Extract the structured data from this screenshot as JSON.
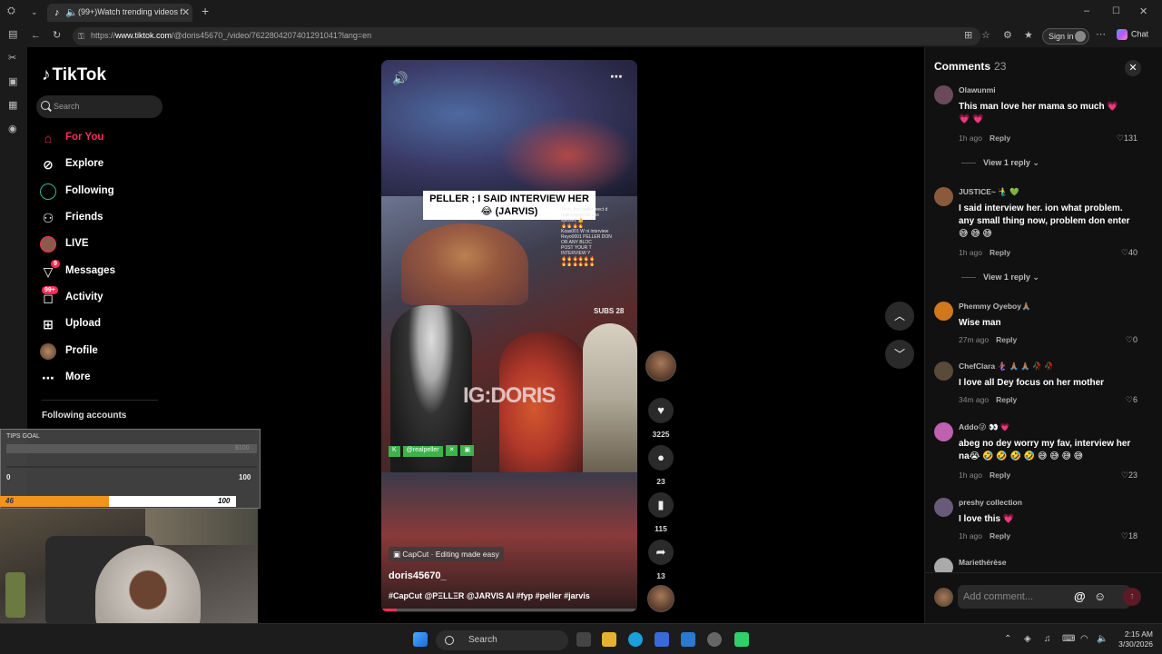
{
  "browser": {
    "tab_title": "(99+)Watch trending videos f",
    "url_prefix": "https://",
    "url_domain": "www.tiktok.com",
    "url_path": "/@doris45670_/video/7622804207401291041?lang=en",
    "sign_in": "Sign in",
    "chat": "Chat"
  },
  "sidebar": {
    "logo": "TikTok",
    "search_placeholder": "Search",
    "items": [
      {
        "label": "For You",
        "icon": "home-icon"
      },
      {
        "label": "Explore",
        "icon": "compass-icon"
      },
      {
        "label": "Following",
        "icon": "following-avatar-icon"
      },
      {
        "label": "Friends",
        "icon": "friends-icon"
      },
      {
        "label": "LIVE",
        "icon": "live-icon"
      },
      {
        "label": "Messages",
        "icon": "messages-icon",
        "badge": "9"
      },
      {
        "label": "Activity",
        "icon": "activity-icon",
        "badge": "99+"
      },
      {
        "label": "Upload",
        "icon": "upload-icon"
      },
      {
        "label": "Profile",
        "icon": "profile-avatar-icon"
      },
      {
        "label": "More",
        "icon": "more-icon"
      }
    ],
    "following_accounts": "Following accounts"
  },
  "video": {
    "caption_overlay": "PELLER ; I SAID INTERVIEW HER 😂 (JARVIS)",
    "watermark": "IG:DORIS",
    "subs_text": "SUBS 28",
    "chat_lines": [
      "Trich_boy  peller wect d",
      "realcontent  No uss",
      "spelse2  👍",
      "🔥🔥🔥🔥",
      "Koas001  W ni interview",
      "Reyo0001  PELLER DON",
      "OR ANY BLOC",
      "POST YOUR T",
      "INTERVIEW Y",
      "🔥🔥🔥🔥🔥🔥",
      "🔥🔥🔥🔥🔥🔥"
    ],
    "green_tag": "@realpeller",
    "capcut_label": "CapCut · Editing made easy",
    "username": "doris45670_",
    "hashtags": "#CapCut @PΞLLΞR @JARVIS AI #fyp #peller #jarvis",
    "progress": 0.06
  },
  "actions": {
    "likes": "3225",
    "comments": "23",
    "saves": "115",
    "shares": "13"
  },
  "comments_panel": {
    "title": "Comments",
    "count": "23",
    "reply_label": "Reply",
    "view_reply": "View 1 reply",
    "items": [
      {
        "user": "Olawunmi",
        "text": "This man love her mama so much 💗 💗 💗",
        "time": "1h ago",
        "likes": "131",
        "color": "#6a4a5a"
      },
      {
        "user": "JUSTICE~ 🧜‍♂️ 💚",
        "text": "I said interview her. ion what problem. any small thing now, problem don enter 😅 😅 😅",
        "time": "1h ago",
        "likes": "40",
        "color": "#8a5a3a"
      },
      {
        "user": "Phemmy Oyeboy🙏🏽",
        "text": "Wise man",
        "time": "27m ago",
        "likes": "0",
        "color": "#d0781c"
      },
      {
        "user": "ChefClara 🧜🏾‍♀️ 🙏🏽 🙏🏽 🥀 🥀",
        "text": "I love all Dey focus on her mother",
        "time": "34m ago",
        "likes": "6",
        "color": "#5a4a3a"
      },
      {
        "user": "Addo😜 👀 💗",
        "text": "abeg no dey worry my fav, interview her na😭 🤣 🤣 🤣 🤣 😅 😅 😅 😅",
        "time": "1h ago",
        "likes": "23",
        "color": "#c060b0"
      },
      {
        "user": "preshy collection",
        "text": "I love this 💗",
        "time": "1h ago",
        "likes": "18",
        "color": "#6a5a7a"
      },
      {
        "user": "Mariethérèse",
        "text": "",
        "time": "",
        "likes": "",
        "color": "#aaa"
      }
    ],
    "add_placeholder": "Add comment..."
  },
  "overlay": {
    "tips_goal": "TIPS GOAL",
    "tips_amount": "$100",
    "min_label": "0",
    "max_label": "100",
    "current": "46",
    "current_max": "100",
    "fill_fraction": 0.46
  },
  "taskbar": {
    "search": "Search",
    "time": "2:15 AM",
    "date": "3/30/2026"
  }
}
